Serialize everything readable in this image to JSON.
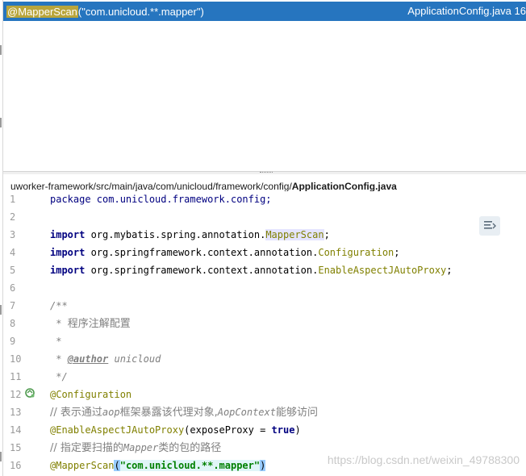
{
  "find_result": {
    "match": "@MapperScan",
    "rest": "(\"com.unicloud.**.mapper\")",
    "file_ref": "ApplicationConfig.java 16"
  },
  "path_bar": {
    "prefix": "uworker-framework/src/main/java/com/unicloud/framework/config/",
    "file": "ApplicationConfig.java"
  },
  "lines": {
    "l1": {
      "num": "1",
      "text": "package com.unicloud.framework.config;"
    },
    "l2": {
      "num": "2"
    },
    "l3": {
      "num": "3",
      "kw": "import",
      "pkg": " org.mybatis.spring.annotation.",
      "cls": "MapperScan",
      "end": ";"
    },
    "l4": {
      "num": "4",
      "kw": "import",
      "pkg": " org.springframework.context.annotation.",
      "cls": "Configuration",
      "end": ";"
    },
    "l5": {
      "num": "5",
      "kw": "import",
      "pkg": " org.springframework.context.annotation.",
      "cls": "EnableAspectJAutoProxy",
      "end": ";"
    },
    "l6": {
      "num": "6"
    },
    "l7": {
      "num": "7",
      "text": "/**"
    },
    "l8": {
      "num": "8",
      "star": " * ",
      "text": "程序注解配置"
    },
    "l9": {
      "num": "9",
      "text": " *"
    },
    "l10": {
      "num": "10",
      "star": " * ",
      "tag": "@author",
      "text": " unicloud"
    },
    "l11": {
      "num": "11",
      "text": " */"
    },
    "l12": {
      "num": "12",
      "text": "@Configuration"
    },
    "l13": {
      "num": "13",
      "a": "// 表示通过",
      "b": "aop",
      "c": "框架暴露该代理对象,",
      "d": "AopContext",
      "e": "能够访问"
    },
    "l14": {
      "num": "14",
      "ann": "@EnableAspectJAutoProxy",
      "open": "(exposeProxy = ",
      "kw": "true",
      "close": ")"
    },
    "l15": {
      "num": "15",
      "a": "// 指定要扫描的",
      "b": "Mapper",
      "c": "类的包的路径"
    },
    "l16": {
      "num": "16",
      "ann": "@MapperScan",
      "open": "(",
      "str": "\"com.unicloud.**.mapper\"",
      "close": ")"
    }
  },
  "watermark": "https://blog.csdn.net/weixin_49788300",
  "colors": {
    "result_bar": "#2675bf",
    "keyword": "#000080",
    "annotation": "#808000",
    "string": "#008000",
    "comment": "#808080"
  }
}
